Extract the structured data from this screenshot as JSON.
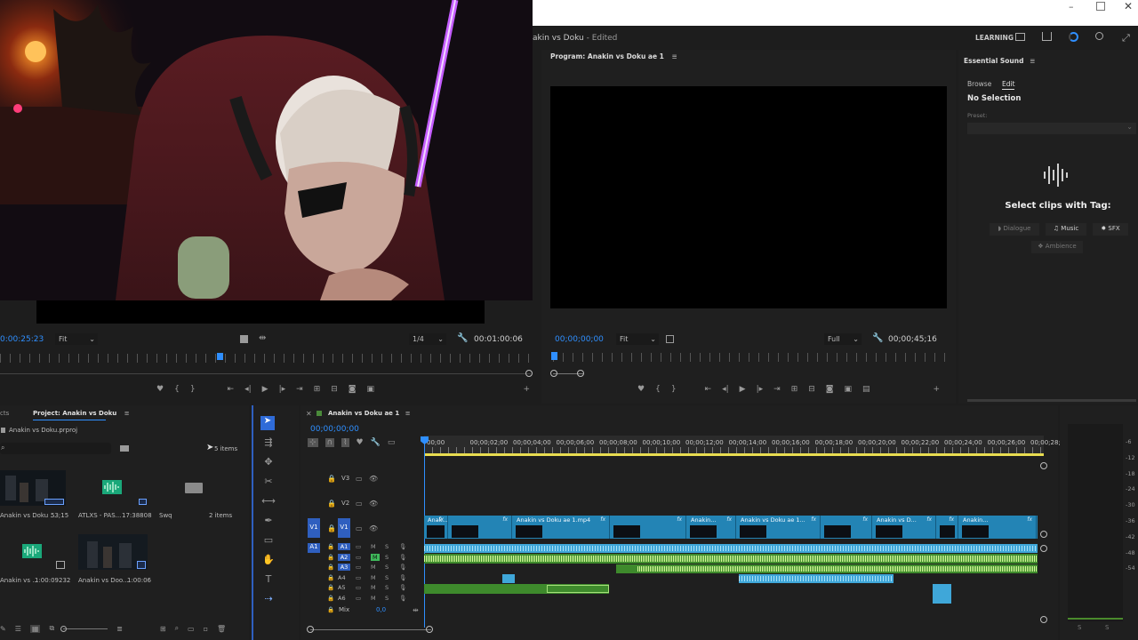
{
  "window": {
    "title": "akin vs Doku",
    "edited": " - Edited",
    "learning": "LEARNING"
  },
  "source_monitor": {
    "timecode": "0:00:25:23",
    "zoom": "Fit",
    "res": "1/4",
    "duration": "00:01:00:06"
  },
  "program": {
    "tab": "Program: Anakin vs Doku ae 1",
    "timecode": "00;00;00;00",
    "zoom": "Fit",
    "quality": "Full",
    "duration": "00;00;45;16"
  },
  "essential_sound": {
    "tab": "Essential Sound",
    "tabs": [
      "Browse",
      "Edit"
    ],
    "no_selection": "No Selection",
    "preset_label": "Preset:",
    "select_clips": "Select clips with Tag:",
    "tags": [
      "Dialogue",
      "Music",
      "SFX",
      "Ambience"
    ]
  },
  "project": {
    "tab_partial": "cts",
    "tab": "Project: Anakin vs Doku",
    "file": "Anakin vs Doku.prproj",
    "items_count": "5 items",
    "items": [
      {
        "name": "Anakin vs Doku ...",
        "dur": "53;15",
        "kind": "video"
      },
      {
        "name": "ATLXS - PAS...",
        "dur": "17:38808",
        "kind": "audio"
      },
      {
        "name": "Swq",
        "dur": "2 items",
        "kind": "folder"
      },
      {
        "name": "Anakin vs ...",
        "dur": "1:00:09232",
        "kind": "audio"
      },
      {
        "name": "Anakin vs Doo...",
        "dur": "1:00:06",
        "kind": "video"
      }
    ]
  },
  "timeline": {
    "tab": "Anakin vs Doku ae 1",
    "timecode": "00;00;00;00",
    "ruler": [
      "00;00",
      "00;00;02;00",
      "00;00;04;00",
      "00;00;06;00",
      "00;00;08;00",
      "00;00;10;00",
      "00;00;12;00",
      "00;00;14;00",
      "00;00;16;00",
      "00;00;18;00",
      "00;00;20;00",
      "00;00;22;00",
      "00;00;24;00",
      "00;00;26;00",
      "00;00;28;00"
    ],
    "video_tracks": [
      "V3",
      "V2",
      "V1"
    ],
    "audio_tracks": [
      "A1",
      "A2",
      "A3",
      "A4",
      "A5",
      "A6"
    ],
    "mix_label": "Mix",
    "mix_value": "0,0",
    "clip_labels": [
      "Anak...",
      "Anakin vs Doku ae 1.mp4",
      "Anakin...",
      "Anakin vs Doku ae 1...",
      "Anakin vs D...",
      "Anakin..."
    ]
  },
  "meter": {
    "scale": [
      "-6",
      "-12",
      "-18",
      "-24",
      "-30",
      "-36",
      "-42",
      "-48",
      "-54"
    ],
    "s_labels": [
      "S",
      "S"
    ]
  }
}
